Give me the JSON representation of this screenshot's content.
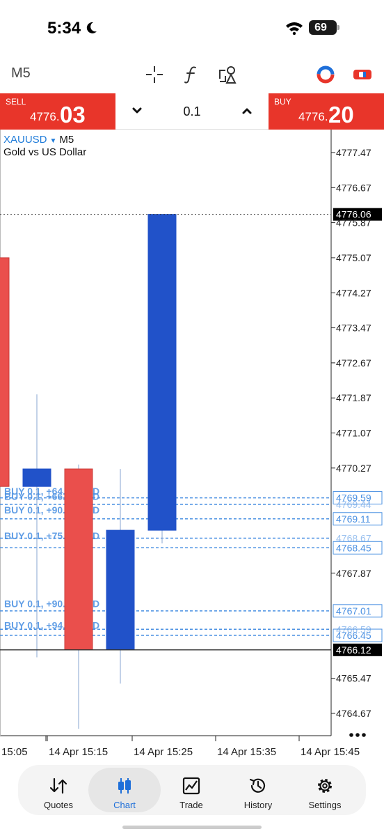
{
  "status_bar": {
    "time": "5:34",
    "battery": "69"
  },
  "toolbar": {
    "timeframe": "M5",
    "icons": [
      "crosshair-icon",
      "function-icon",
      "objects-icon",
      "account-icon",
      "trade-panel-icon"
    ]
  },
  "trade": {
    "sell_label": "SELL",
    "sell_price_small": "4776.",
    "sell_price_big": "03",
    "buy_label": "BUY",
    "buy_price_small": "4776.",
    "buy_price_big": "20",
    "lot": "0.1"
  },
  "chart": {
    "symbol": "XAUUSD",
    "timeframe": "M5",
    "description": "Gold vs US Dollar",
    "colors": {
      "bull": "#2152c9",
      "bear": "#ea4f4c",
      "order_line": "#4a90e2",
      "label_bg": "#000000"
    }
  },
  "chart_data": {
    "type": "candlestick",
    "price_axis": {
      "ticks": [
        "4777.47",
        "4776.67",
        "4775.87",
        "4775.07",
        "4774.27",
        "4773.47",
        "4772.67",
        "4771.87",
        "4771.07",
        "4770.27",
        "4767.87",
        "4765.47",
        "4764.67"
      ],
      "range": [
        4764.3,
        4778.0
      ]
    },
    "time_axis": {
      "labels": [
        "15:05",
        "14 Apr 15:15",
        "14 Apr 15:25",
        "14 Apr 15:35",
        "14 Apr 15:45"
      ]
    },
    "candles": [
      {
        "open": 4775.07,
        "high": 4775.35,
        "low": 4769.85,
        "close": 4769.85,
        "dir": "bear"
      },
      {
        "open": 4769.85,
        "high": 4771.95,
        "low": 4765.95,
        "close": 4770.25,
        "dir": "bull"
      },
      {
        "open": 4770.25,
        "high": 4770.35,
        "low": 4764.32,
        "close": 4766.12,
        "dir": "bear"
      },
      {
        "open": 4766.12,
        "high": 4770.25,
        "low": 4765.35,
        "close": 4768.85,
        "dir": "bull"
      },
      {
        "open": 4768.85,
        "high": 4776.06,
        "low": 4768.55,
        "close": 4776.06,
        "dir": "bull"
      }
    ],
    "current_price_labels": [
      "4776.06",
      "4766.12"
    ],
    "order_price_labels": [
      "4769.59",
      "4769.11",
      "4768.45",
      "4767.01",
      "4766.45"
    ],
    "order_price_labels_partial": [
      "4769.44",
      "4768.67",
      "4766.59"
    ],
    "order_line_texts": [
      "BUY 0.1, +64.20 USD",
      "BUY 0.1, +66.20 USD",
      "BUY 0.1, +90.30 USD",
      "BUY 0.1, +75.00 USD",
      "BUY 0.1, +90.30 USD",
      "BUY 0.1, +94.70 USD"
    ]
  },
  "nav": {
    "items": [
      {
        "label": "Quotes",
        "icon": "quotes-icon"
      },
      {
        "label": "Chart",
        "icon": "chart-icon"
      },
      {
        "label": "Trade",
        "icon": "trade-icon"
      },
      {
        "label": "History",
        "icon": "history-icon"
      },
      {
        "label": "Settings",
        "icon": "settings-icon"
      }
    ],
    "active": "Chart"
  }
}
